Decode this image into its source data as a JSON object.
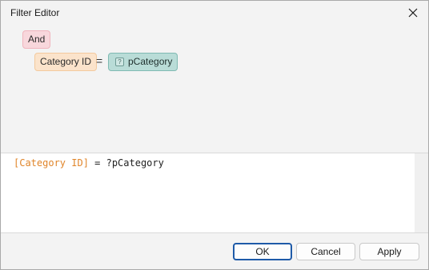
{
  "window": {
    "title": "Filter Editor",
    "close_icon": "close-icon"
  },
  "tree": {
    "group_operator": "And",
    "condition": {
      "field": "Category ID",
      "operator": "=",
      "value": "pCategory",
      "value_icon": "parameter-icon",
      "value_icon_glyph": "?"
    }
  },
  "expression": {
    "field": "[Category ID]",
    "rest": " = ?pCategory"
  },
  "buttons": {
    "ok": "OK",
    "cancel": "Cancel",
    "apply": "Apply"
  },
  "colors": {
    "group_node": "#f8d7dc",
    "field_node": "#fbe3cb",
    "value_node": "#b9dcd7",
    "expression_field": "#e0852a",
    "default_button_border": "#1e5aa8"
  }
}
